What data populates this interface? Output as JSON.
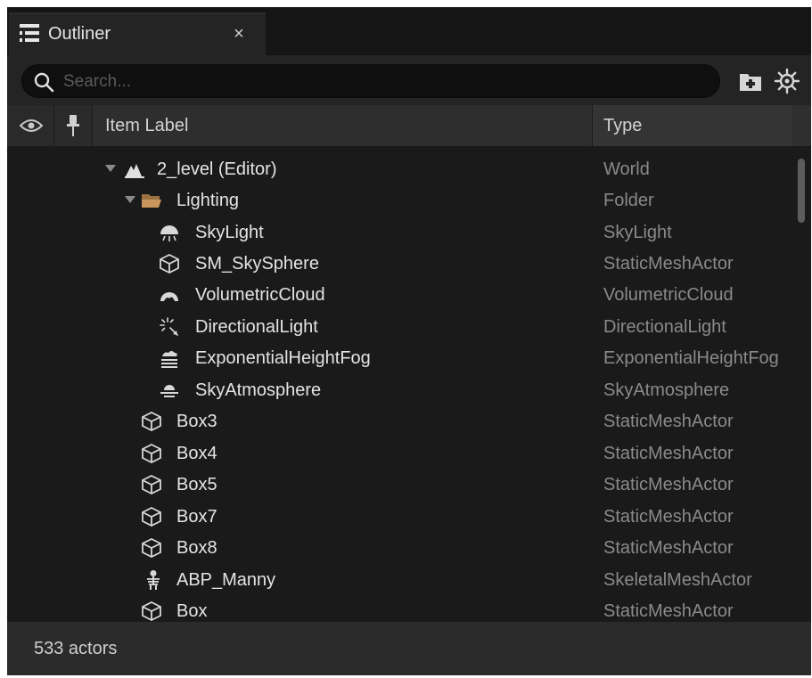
{
  "tab": {
    "title": "Outliner",
    "close_glyph": "×",
    "icon": "outliner-list-icon"
  },
  "search": {
    "placeholder": "Search...",
    "value": ""
  },
  "toolbar": {
    "new_folder_icon": "add-folder-icon",
    "settings_icon": "settings-gear-icon"
  },
  "columns": {
    "visibility_icon": "eye-icon",
    "pin_icon": "pin-icon",
    "label": "Item Label",
    "type": "Type"
  },
  "rows": [
    {
      "label": "2_level (Editor)",
      "type": "World",
      "icon": "world-icon",
      "expanded": true
    },
    {
      "label": "Lighting",
      "type": "Folder",
      "icon": "folder-icon",
      "expanded": true
    },
    {
      "label": "SkyLight",
      "type": "SkyLight",
      "icon": "skylight-icon"
    },
    {
      "label": "SM_SkySphere",
      "type": "StaticMeshActor",
      "icon": "static-mesh-icon"
    },
    {
      "label": "VolumetricCloud",
      "type": "VolumetricCloud",
      "icon": "volumetric-cloud-icon"
    },
    {
      "label": "DirectionalLight",
      "type": "DirectionalLight",
      "icon": "directional-light-icon"
    },
    {
      "label": "ExponentialHeightFog",
      "type": "ExponentialHeightFog",
      "icon": "height-fog-icon"
    },
    {
      "label": "SkyAtmosphere",
      "type": "SkyAtmosphere",
      "icon": "sky-atmosphere-icon"
    },
    {
      "label": "Box3",
      "type": "StaticMeshActor",
      "icon": "static-mesh-icon"
    },
    {
      "label": "Box4",
      "type": "StaticMeshActor",
      "icon": "static-mesh-icon"
    },
    {
      "label": "Box5",
      "type": "StaticMeshActor",
      "icon": "static-mesh-icon"
    },
    {
      "label": "Box7",
      "type": "StaticMeshActor",
      "icon": "static-mesh-icon"
    },
    {
      "label": "Box8",
      "type": "StaticMeshActor",
      "icon": "static-mesh-icon"
    },
    {
      "label": "ABP_Manny",
      "type": "SkeletalMeshActor",
      "icon": "skeletal-mesh-icon"
    },
    {
      "label": "Box",
      "type": "StaticMeshActor",
      "icon": "static-mesh-icon"
    }
  ],
  "footer": {
    "actor_count": "533 actors"
  },
  "colors": {
    "panel_bg": "#1a1a1a",
    "header_bg": "#2f2f2f",
    "label_text": "#e4e4e4",
    "type_text": "#8a8a8a",
    "folder_accent": "#c8965a"
  }
}
